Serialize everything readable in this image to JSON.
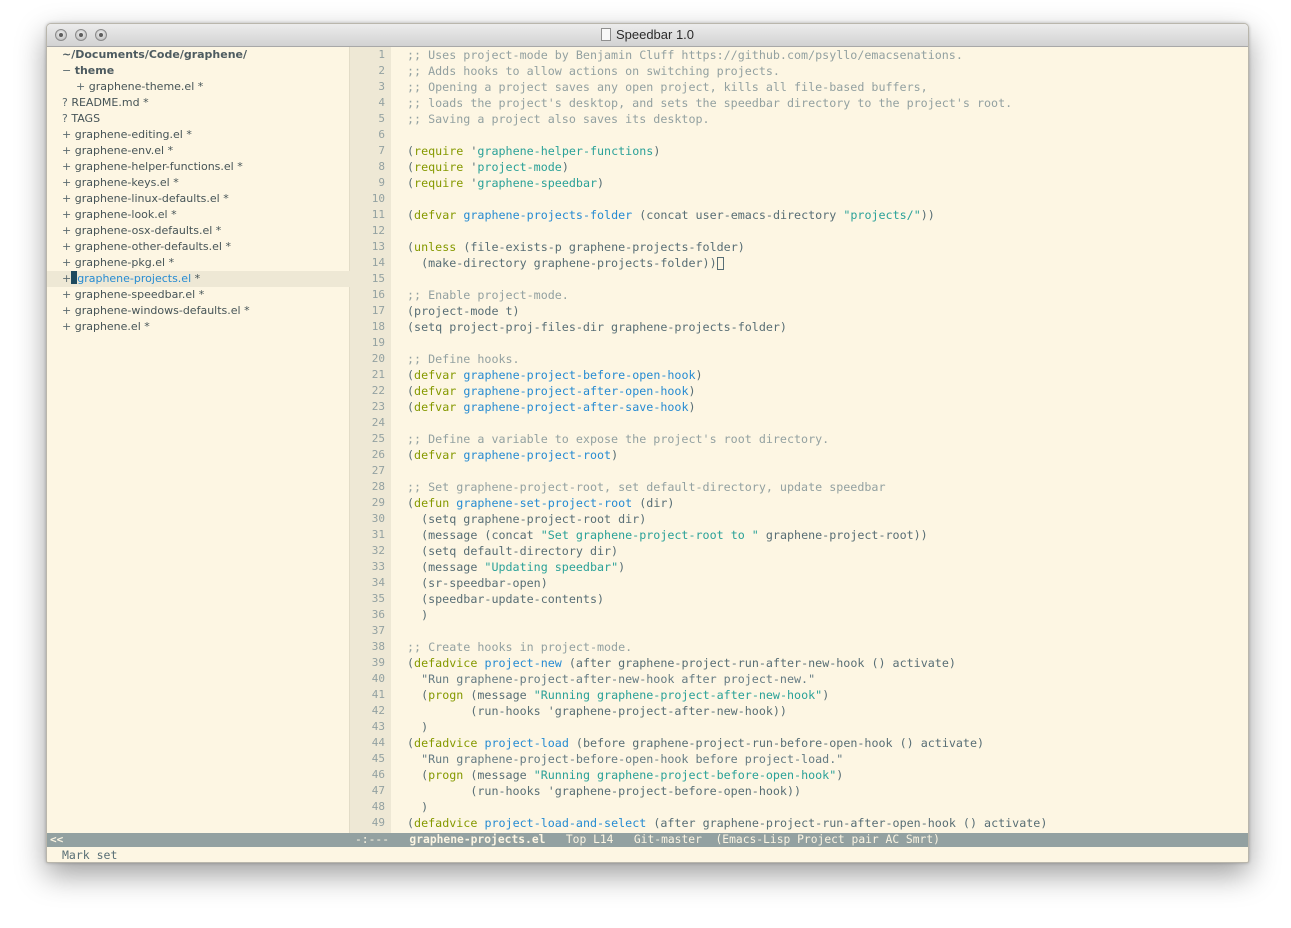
{
  "window": {
    "title": "Speedbar 1.0"
  },
  "speedbar": {
    "root": "~/Documents/Code/graphene/",
    "items": [
      {
        "prefix": "−",
        "name": "theme",
        "suffix": "",
        "kind": "dir"
      },
      {
        "prefix": "+",
        "name": "graphene-theme.el",
        "suffix": "*",
        "kind": "file"
      },
      {
        "prefix": "?",
        "name": "README.md",
        "suffix": "*",
        "kind": "file"
      },
      {
        "prefix": "?",
        "name": "TAGS",
        "suffix": "",
        "kind": "file"
      },
      {
        "prefix": "+",
        "name": "graphene-editing.el",
        "suffix": "*",
        "kind": "file"
      },
      {
        "prefix": "+",
        "name": "graphene-env.el",
        "suffix": "*",
        "kind": "file"
      },
      {
        "prefix": "+",
        "name": "graphene-helper-functions.el",
        "suffix": "*",
        "kind": "file"
      },
      {
        "prefix": "+",
        "name": "graphene-keys.el",
        "suffix": "*",
        "kind": "file"
      },
      {
        "prefix": "+",
        "name": "graphene-linux-defaults.el",
        "suffix": "*",
        "kind": "file"
      },
      {
        "prefix": "+",
        "name": "graphene-look.el",
        "suffix": "*",
        "kind": "file"
      },
      {
        "prefix": "+",
        "name": "graphene-osx-defaults.el",
        "suffix": "*",
        "kind": "file"
      },
      {
        "prefix": "+",
        "name": "graphene-other-defaults.el",
        "suffix": "*",
        "kind": "file"
      },
      {
        "prefix": "+",
        "name": "graphene-pkg.el",
        "suffix": "*",
        "kind": "file"
      },
      {
        "prefix": "+",
        "name": "graphene-projects.el",
        "suffix": "*",
        "kind": "file",
        "active": true
      },
      {
        "prefix": "+",
        "name": "graphene-speedbar.el",
        "suffix": "*",
        "kind": "file"
      },
      {
        "prefix": "+",
        "name": "graphene-windows-defaults.el",
        "suffix": "*",
        "kind": "file"
      },
      {
        "prefix": "+",
        "name": "graphene.el",
        "suffix": "*",
        "kind": "file"
      }
    ],
    "modeline_label": "<<"
  },
  "editor": {
    "lines": [
      [
        [
          "com",
          ";; Uses project-mode by Benjamin Cluff https://github.com/psyllo/emacsenations."
        ]
      ],
      [
        [
          "com",
          ";; Adds hooks to allow actions on switching projects."
        ]
      ],
      [
        [
          "com",
          ";; Opening a project saves any open project, kills all file-based buffers,"
        ]
      ],
      [
        [
          "com",
          ";; loads the project's desktop, and sets the speedbar directory to the project's root."
        ]
      ],
      [
        [
          "com",
          ";; Saving a project also saves its desktop."
        ]
      ],
      [],
      [
        [
          "p",
          "("
        ],
        [
          "kw",
          "require"
        ],
        [
          "p",
          " '"
        ],
        [
          "str",
          "graphene-helper-functions"
        ],
        [
          "p",
          ")"
        ]
      ],
      [
        [
          "p",
          "("
        ],
        [
          "kw",
          "require"
        ],
        [
          "p",
          " '"
        ],
        [
          "str",
          "project-mode"
        ],
        [
          "p",
          ")"
        ]
      ],
      [
        [
          "p",
          "("
        ],
        [
          "kw",
          "require"
        ],
        [
          "p",
          " '"
        ],
        [
          "str",
          "graphene-speedbar"
        ],
        [
          "p",
          ")"
        ]
      ],
      [],
      [
        [
          "p",
          "("
        ],
        [
          "kw",
          "defvar"
        ],
        [
          "p",
          " "
        ],
        [
          "fn",
          "graphene-projects-folder"
        ],
        [
          "p",
          " (concat user-emacs-directory "
        ],
        [
          "str",
          "\"projects/\""
        ],
        [
          "p",
          "))"
        ]
      ],
      [],
      [
        [
          "p",
          "("
        ],
        [
          "kw",
          "unless"
        ],
        [
          "p",
          " (file-exists-p graphene-projects-folder)"
        ]
      ],
      [
        [
          "p",
          "  (make-directory graphene-projects-folder))"
        ],
        [
          "cur",
          ""
        ]
      ],
      [],
      [
        [
          "com",
          ";; Enable project-mode."
        ]
      ],
      [
        [
          "p",
          "(project-mode t)"
        ]
      ],
      [
        [
          "p",
          "(setq project-proj-files-dir graphene-projects-folder)"
        ]
      ],
      [],
      [
        [
          "com",
          ";; Define hooks."
        ]
      ],
      [
        [
          "p",
          "("
        ],
        [
          "kw",
          "defvar"
        ],
        [
          "p",
          " "
        ],
        [
          "fn",
          "graphene-project-before-open-hook"
        ],
        [
          "p",
          ")"
        ]
      ],
      [
        [
          "p",
          "("
        ],
        [
          "kw",
          "defvar"
        ],
        [
          "p",
          " "
        ],
        [
          "fn",
          "graphene-project-after-open-hook"
        ],
        [
          "p",
          ")"
        ]
      ],
      [
        [
          "p",
          "("
        ],
        [
          "kw",
          "defvar"
        ],
        [
          "p",
          " "
        ],
        [
          "fn",
          "graphene-project-after-save-hook"
        ],
        [
          "p",
          ")"
        ]
      ],
      [],
      [
        [
          "com",
          ";; Define a variable to expose the project's root directory."
        ]
      ],
      [
        [
          "p",
          "("
        ],
        [
          "kw",
          "defvar"
        ],
        [
          "p",
          " "
        ],
        [
          "fn",
          "graphene-project-root"
        ],
        [
          "p",
          ")"
        ]
      ],
      [],
      [
        [
          "com",
          ";; Set graphene-project-root, set default-directory, update speedbar"
        ]
      ],
      [
        [
          "p",
          "("
        ],
        [
          "kw",
          "defun"
        ],
        [
          "p",
          " "
        ],
        [
          "fn",
          "graphene-set-project-root"
        ],
        [
          "p",
          " (dir)"
        ]
      ],
      [
        [
          "p",
          "  (setq graphene-project-root dir)"
        ]
      ],
      [
        [
          "p",
          "  (message (concat "
        ],
        [
          "str",
          "\"Set graphene-project-root to \""
        ],
        [
          "p",
          " graphene-project-root))"
        ]
      ],
      [
        [
          "p",
          "  (setq default-directory dir)"
        ]
      ],
      [
        [
          "p",
          "  (message "
        ],
        [
          "str",
          "\"Updating speedbar\""
        ],
        [
          "p",
          ")"
        ]
      ],
      [
        [
          "p",
          "  (sr-speedbar-open)"
        ]
      ],
      [
        [
          "p",
          "  (speedbar-update-contents)"
        ]
      ],
      [
        [
          "p",
          "  )"
        ]
      ],
      [],
      [
        [
          "com",
          ";; Create hooks in project-mode."
        ]
      ],
      [
        [
          "p",
          "("
        ],
        [
          "kw",
          "defadvice"
        ],
        [
          "p",
          " "
        ],
        [
          "fn",
          "project-new"
        ],
        [
          "p",
          " (after graphene-project-run-after-new-hook () activate)"
        ]
      ],
      [
        [
          "doc",
          "  \"Run graphene-project-after-new-hook after project-new.\""
        ]
      ],
      [
        [
          "p",
          "  ("
        ],
        [
          "kw",
          "progn"
        ],
        [
          "p",
          " (message "
        ],
        [
          "str",
          "\"Running graphene-project-after-new-hook\""
        ],
        [
          "p",
          ")"
        ]
      ],
      [
        [
          "p",
          "         (run-hooks 'graphene-project-after-new-hook))"
        ]
      ],
      [
        [
          "p",
          "  )"
        ]
      ],
      [
        [
          "p",
          "("
        ],
        [
          "kw",
          "defadvice"
        ],
        [
          "p",
          " "
        ],
        [
          "fn",
          "project-load"
        ],
        [
          "p",
          " (before graphene-project-run-before-open-hook () activate)"
        ]
      ],
      [
        [
          "doc",
          "  \"Run graphene-project-before-open-hook before project-load.\""
        ]
      ],
      [
        [
          "p",
          "  ("
        ],
        [
          "kw",
          "progn"
        ],
        [
          "p",
          " (message "
        ],
        [
          "str",
          "\"Running graphene-project-before-open-hook\""
        ],
        [
          "p",
          ")"
        ]
      ],
      [
        [
          "p",
          "         (run-hooks 'graphene-project-before-open-hook))"
        ]
      ],
      [
        [
          "p",
          "  )"
        ]
      ],
      [
        [
          "p",
          "("
        ],
        [
          "kw",
          "defadvice"
        ],
        [
          "p",
          " "
        ],
        [
          "fn",
          "project-load-and-select"
        ],
        [
          "p",
          " (after graphene-project-run-after-open-hook () activate)"
        ]
      ]
    ]
  },
  "modeline": {
    "status": "-:---",
    "buffer": "graphene-projects.el",
    "position": "Top L14",
    "vc": "Git-master",
    "modes": "(Emacs-Lisp Project pair AC Smrt)"
  },
  "minibuffer": {
    "message": "Mark set"
  },
  "colors": {
    "background": "#fdf6e3",
    "comment": "#93a1a1",
    "keyword": "#859900",
    "function": "#268bd2",
    "string": "#2aa198",
    "modeline": "#93a1a1"
  }
}
